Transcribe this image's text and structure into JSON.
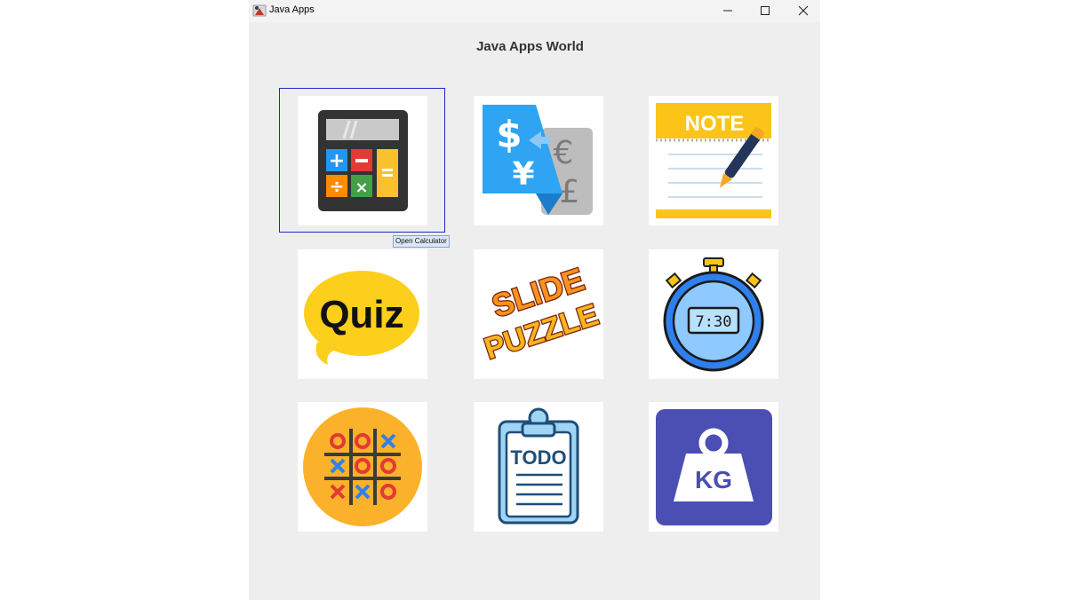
{
  "window": {
    "title": "Java Apps"
  },
  "heading": "Java Apps World",
  "apps": [
    {
      "id": "calculator",
      "icon": "calculator-icon",
      "tooltip": "Open Calculator",
      "focused": true
    },
    {
      "id": "currency-converter",
      "icon": "currency-exchange-icon",
      "labels": [
        "$",
        "¥",
        "€",
        "£"
      ]
    },
    {
      "id": "notes",
      "icon": "note-pad-icon",
      "labels": [
        "NOTE"
      ]
    },
    {
      "id": "quiz",
      "icon": "quiz-bubble-icon",
      "labels": [
        "Quiz"
      ]
    },
    {
      "id": "slide-puzzle",
      "icon": "slide-puzzle-icon",
      "labels": [
        "SLIDE",
        "PUZZLE"
      ]
    },
    {
      "id": "stopwatch",
      "icon": "stopwatch-icon",
      "labels": [
        "7:30"
      ]
    },
    {
      "id": "tic-tac-toe",
      "icon": "tic-tac-toe-icon"
    },
    {
      "id": "todo",
      "icon": "todo-clipboard-icon",
      "labels": [
        "TODO"
      ]
    },
    {
      "id": "weight-converter",
      "icon": "kg-weight-icon",
      "labels": [
        "KG"
      ]
    }
  ],
  "colors": {
    "window_bg": "#eeeeee",
    "titlebar_bg": "#f3f3f3",
    "focus_border": "#1d2bc2",
    "tooltip_bg": "#dbe7f6"
  }
}
